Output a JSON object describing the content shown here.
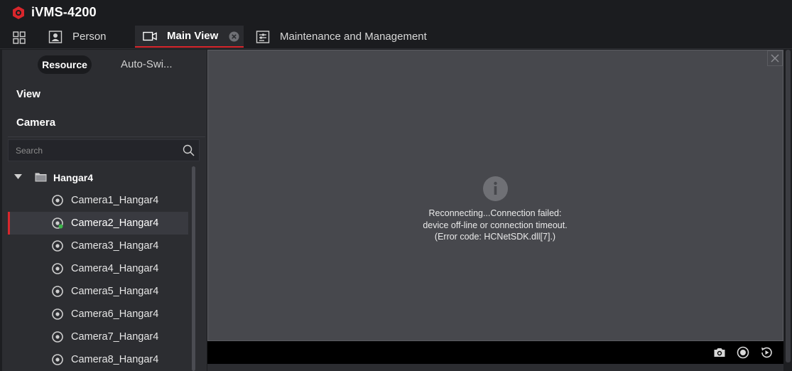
{
  "app": {
    "title": "iVMS-4200"
  },
  "tabs": [
    {
      "label": "Person"
    },
    {
      "label": "Main View"
    },
    {
      "label": "Maintenance and Management"
    }
  ],
  "left": {
    "subtabs": {
      "resource": "Resource",
      "autoswitch": "Auto-Swi..."
    },
    "sections": {
      "view": "View",
      "camera": "Camera"
    },
    "search": {
      "placeholder": "Search"
    },
    "tree": {
      "root": "Hangar4",
      "cameras": [
        "Camera1_Hangar4",
        "Camera2_Hangar4",
        "Camera3_Hangar4",
        "Camera4_Hangar4",
        "Camera5_Hangar4",
        "Camera6_Hangar4",
        "Camera7_Hangar4",
        "Camera8_Hangar4"
      ],
      "selected_index": 1
    }
  },
  "video": {
    "message_lines": [
      "Reconnecting...Connection failed:",
      "device off-line or connection timeout.",
      "(Error code: HCNetSDK.dll[7].)"
    ]
  },
  "colors": {
    "accent": "#d9262c",
    "panel": "#2c2d31",
    "video_bg": "#47484d"
  },
  "icons": [
    "hikvision-logo",
    "grid-icon",
    "person-icon",
    "camera-tab-icon",
    "close-icon",
    "maintenance-icon",
    "search-icon",
    "folder-icon",
    "camera-icon",
    "info-icon",
    "snapshot-icon",
    "record-icon",
    "playback-icon"
  ]
}
